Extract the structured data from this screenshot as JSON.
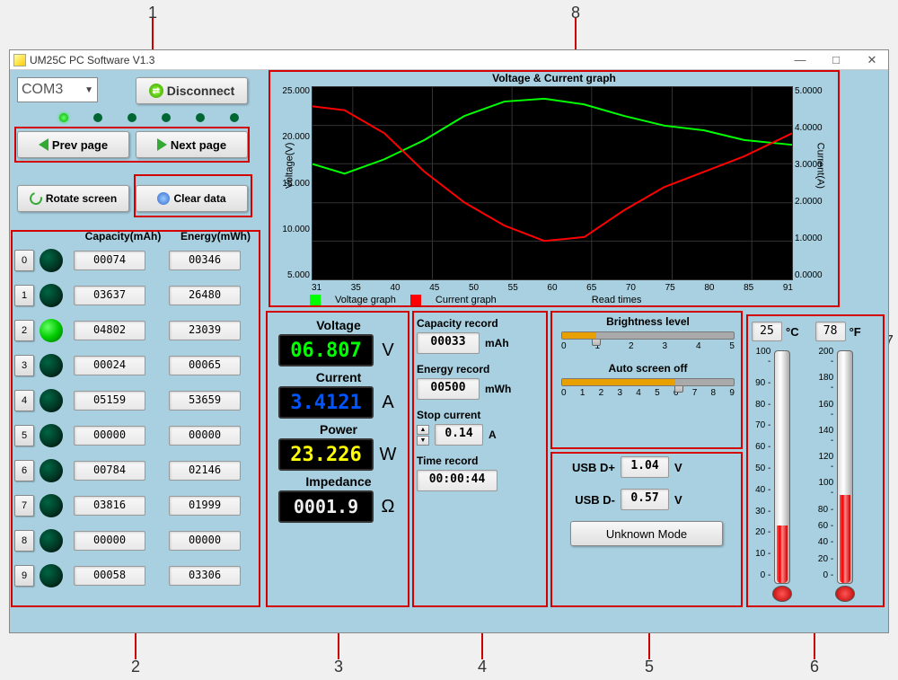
{
  "annotations": {
    "1": "1",
    "2": "2",
    "3": "3",
    "4": "4",
    "5": "5",
    "6": "6",
    "7": "7",
    "8": "8"
  },
  "window": {
    "title": "UM25C PC Software V1.3",
    "min": "—",
    "max": "□",
    "close": "✕"
  },
  "combo": {
    "value": "COM3"
  },
  "buttons": {
    "disconnect": "Disconnect",
    "prev": "Prev page",
    "next": "Next page",
    "rotate": "Rotate screen",
    "clear": "Clear data"
  },
  "table": {
    "head_cap": "Capacity(mAh)",
    "head_en": "Energy(mWh)",
    "rows": [
      {
        "idx": "0",
        "cap": "00074",
        "en": "00346",
        "on": false
      },
      {
        "idx": "1",
        "cap": "03637",
        "en": "26480",
        "on": false
      },
      {
        "idx": "2",
        "cap": "04802",
        "en": "23039",
        "on": true
      },
      {
        "idx": "3",
        "cap": "00024",
        "en": "00065",
        "on": false
      },
      {
        "idx": "4",
        "cap": "05159",
        "en": "53659",
        "on": false
      },
      {
        "idx": "5",
        "cap": "00000",
        "en": "00000",
        "on": false
      },
      {
        "idx": "6",
        "cap": "00784",
        "en": "02146",
        "on": false
      },
      {
        "idx": "7",
        "cap": "03816",
        "en": "01999",
        "on": false
      },
      {
        "idx": "8",
        "cap": "00000",
        "en": "00000",
        "on": false
      },
      {
        "idx": "9",
        "cap": "00058",
        "en": "03306",
        "on": false
      }
    ]
  },
  "meas": {
    "voltage_label": "Voltage",
    "voltage": "06.807",
    "voltage_u": "V",
    "current_label": "Current",
    "current": "3.4121",
    "current_u": "A",
    "power_label": "Power",
    "power": "23.226",
    "power_u": "W",
    "impedance_label": "Impedance",
    "impedance": "0001.9",
    "impedance_u": "Ω"
  },
  "rec": {
    "cap_label": "Capacity record",
    "cap": "00033",
    "cap_u": "mAh",
    "en_label": "Energy record",
    "en": "00500",
    "en_u": "mWh",
    "stop_label": "Stop current",
    "stop": "0.14",
    "stop_u": "A",
    "time_label": "Time record",
    "time": "00:00:44"
  },
  "bright": {
    "label": "Brightness level",
    "pos": 1,
    "ticks": [
      "0",
      "1",
      "2",
      "3",
      "4",
      "5"
    ],
    "aos_label": "Auto screen off",
    "aos_pos": 6,
    "aos_ticks": [
      "0",
      "1",
      "2",
      "3",
      "4",
      "5",
      "6",
      "7",
      "8",
      "9"
    ]
  },
  "usb": {
    "dp_label": "USB D+",
    "dp": "1.04",
    "dm_label": "USB D-",
    "dm": "0.57",
    "u": "V",
    "mode": "Unknown Mode"
  },
  "temp": {
    "c": "25",
    "c_u": "°C",
    "c_ticks": [
      "100",
      "90",
      "80",
      "70",
      "60",
      "50",
      "40",
      "30",
      "20",
      "10",
      "0"
    ],
    "f": "78",
    "f_u": "°F",
    "f_ticks": [
      "200",
      "180",
      "160",
      "140",
      "120",
      "100",
      "80",
      "60",
      "40",
      "20",
      "0"
    ]
  },
  "chart": {
    "title": "Voltage & Current graph",
    "y1label": "Voltage(V)",
    "y2label": "Current(A)",
    "y1ticks": [
      "25.000",
      "20.000",
      "15.000",
      "10.000",
      "5.000"
    ],
    "y2ticks": [
      "5.0000",
      "4.0000",
      "3.0000",
      "2.0000",
      "1.0000",
      "0.0000"
    ],
    "xticks": [
      "31",
      "35",
      "40",
      "45",
      "50",
      "55",
      "60",
      "65",
      "70",
      "75",
      "80",
      "85",
      "91"
    ],
    "xlabel": "Read times",
    "legend_v": "Voltage graph",
    "legend_c": "Current graph"
  },
  "chart_data": {
    "type": "line",
    "title": "Voltage & Current graph",
    "xlabel": "Read times",
    "y1label": "Voltage(V)",
    "y2label": "Current(A)",
    "x_range": [
      31,
      91
    ],
    "y1_range": [
      5.0,
      25.0
    ],
    "y2_range": [
      0.0,
      5.0
    ],
    "series": [
      {
        "name": "Voltage graph",
        "axis": "y1",
        "color": "#00ff00",
        "x": [
          31,
          35,
          40,
          45,
          50,
          55,
          60,
          65,
          70,
          75,
          80,
          85,
          91
        ],
        "y": [
          17.0,
          16.0,
          17.5,
          19.5,
          22.0,
          23.5,
          23.8,
          23.2,
          22.0,
          21.0,
          20.5,
          19.5,
          19.0
        ]
      },
      {
        "name": "Current graph",
        "axis": "y2",
        "color": "#ff0000",
        "x": [
          31,
          35,
          40,
          45,
          50,
          55,
          60,
          65,
          70,
          75,
          80,
          85,
          91
        ],
        "y": [
          4.5,
          4.4,
          3.8,
          2.8,
          2.0,
          1.4,
          1.0,
          1.1,
          1.8,
          2.4,
          2.8,
          3.2,
          3.8
        ]
      }
    ]
  }
}
